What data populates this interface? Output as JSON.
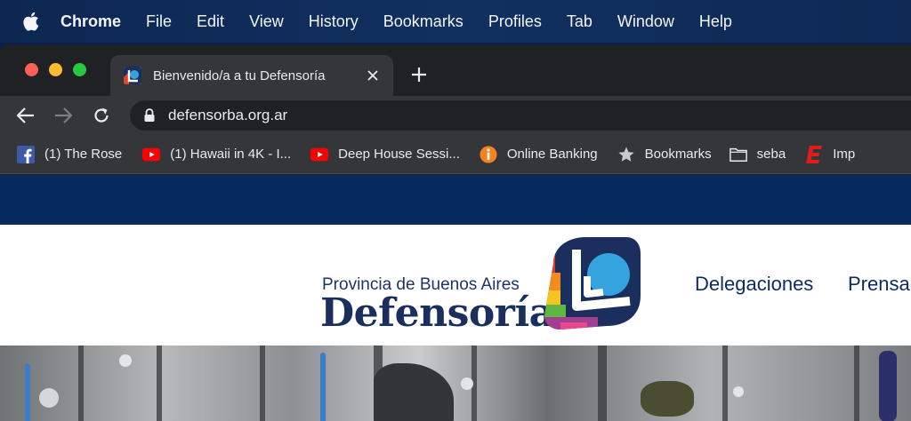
{
  "menubar": {
    "app_name": "Chrome",
    "items": [
      "File",
      "Edit",
      "View",
      "History",
      "Bookmarks",
      "Profiles",
      "Tab",
      "Window",
      "Help"
    ]
  },
  "tab": {
    "title": "Bienvenido/a a tu Defensoría"
  },
  "omnibox": {
    "url": "defensorba.org.ar"
  },
  "bookmarks": [
    {
      "label": "(1) The Rose",
      "icon": "facebook-icon"
    },
    {
      "label": "(1) Hawaii in 4K - I...",
      "icon": "youtube-icon"
    },
    {
      "label": "Deep House Sessi...",
      "icon": "youtube-icon"
    },
    {
      "label": "Online Banking",
      "icon": "bank-icon"
    },
    {
      "label": "Bookmarks",
      "icon": "star-icon"
    },
    {
      "label": "seba",
      "icon": "folder-icon"
    },
    {
      "label": "Imp",
      "icon": "e-icon"
    }
  ],
  "site": {
    "logo_subtitle": "Provincia de Buenos Aires",
    "logo_title": "Defensoría",
    "nav": [
      "Delegaciones",
      "Prensa"
    ]
  },
  "colors": {
    "topband": "#062a5c",
    "nav_text": "#0b2c5e",
    "logo_blue": "#1a2f5e",
    "logo_light_blue": "#35a3dd"
  }
}
